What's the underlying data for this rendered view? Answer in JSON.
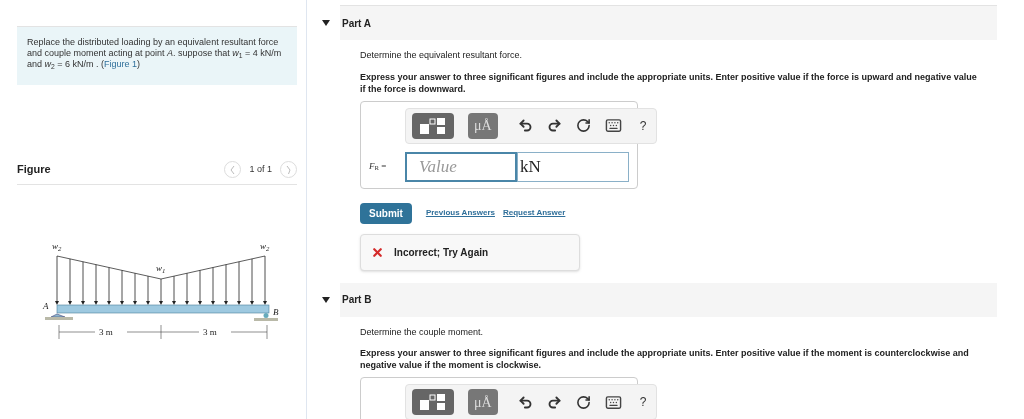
{
  "problem": {
    "text": "Replace the distributed loading by an equivalent resultant force and couple moment acting at point *A*. suppose that *w*$_{1}$ = 4 kN/m and *w*$_{2}$ = 6 kN/m . (",
    "link": "Figure 1",
    "text_end": ")"
  },
  "figure": {
    "title": "Figure",
    "pager": "1 of 1",
    "labels": {
      "w_left": "w$_{2}$",
      "w_mid": "w$_{1}$",
      "w_right": "w$_{2}$",
      "a": "A",
      "b": "B",
      "span_left": "3 m",
      "span_right": "3 m"
    }
  },
  "parts": [
    {
      "title": "Part A",
      "expanded": true,
      "prompt": "Determine the equivalent resultant force.",
      "instructions": "Express your answer to three significant figures and include the appropriate units. Enter positive value if the force is upward and negative value if the force is downward.",
      "toolbar": {
        "units_label": "μÅ",
        "help": "?"
      },
      "answer": {
        "label": "*F*$_{R}$ =",
        "placeholder": "Value",
        "unit": "kN"
      },
      "submit": "Submit",
      "links": [
        "Previous Answers",
        "Request Answer"
      ],
      "feedback": {
        "kind": "incorrect",
        "text": "Incorrect; Try Again"
      }
    },
    {
      "title": "Part B",
      "expanded": true,
      "prompt": "Determine the couple moment.",
      "instructions": "Express your answer to three significant figures and include the appropriate units. Enter positive value if the moment is counterclockwise and negative value if the moment is clockwise.",
      "toolbar": {
        "units_label": "μÅ",
        "help": "?"
      }
    }
  ]
}
